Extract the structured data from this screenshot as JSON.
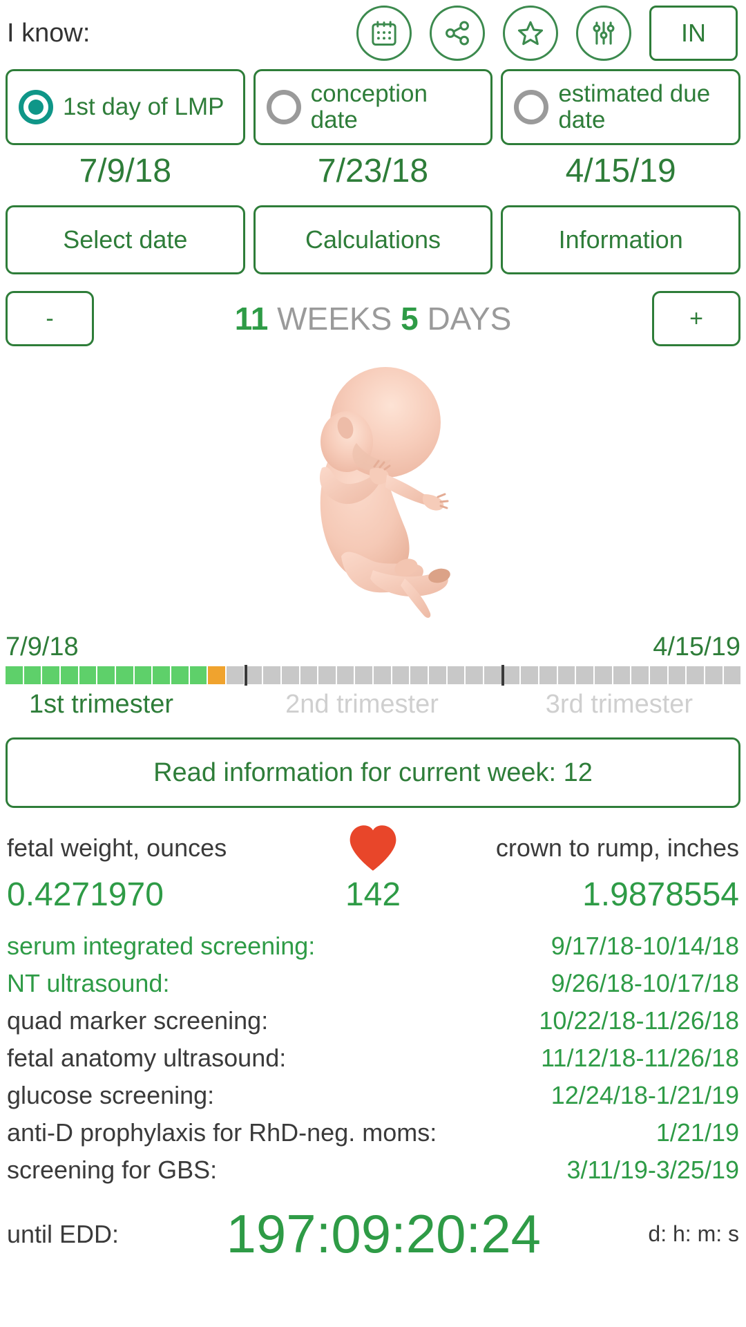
{
  "header": {
    "i_know_label": "I know:",
    "icons": [
      {
        "name": "calendar-icon"
      },
      {
        "name": "share-icon"
      },
      {
        "name": "star-icon"
      },
      {
        "name": "settings-sliders-icon"
      }
    ],
    "in_button_label": "IN"
  },
  "method_options": [
    {
      "label": "1st day of LMP",
      "selected": true,
      "date": "7/9/18"
    },
    {
      "label": "conception date",
      "selected": false,
      "date": "7/23/18"
    },
    {
      "label": "estimated due date",
      "selected": false,
      "date": "4/15/19"
    }
  ],
  "actions": {
    "select_date": "Select date",
    "calculations": "Calculations",
    "information": "Information"
  },
  "stepper": {
    "minus": "-",
    "plus": "+",
    "weeks_value": "11",
    "weeks_unit": "WEEKS",
    "days_value": "5",
    "days_unit": "DAYS"
  },
  "timeline": {
    "start_date": "7/9/18",
    "end_date": "4/15/19",
    "total_weeks": 40,
    "weeks_completed": 11,
    "current_week_index": 11,
    "trimester_ticks": [
      13,
      27
    ],
    "trimester_labels": [
      "1st trimester",
      "2nd trimester",
      "3rd trimester"
    ]
  },
  "read_info_button": "Read information for current week: 12",
  "stats": {
    "weight_label": "fetal weight, ounces",
    "weight_value": "0.4271970",
    "heart_icon": "heart-icon",
    "heartbeat_value": "142",
    "length_label": "crown to rump, inches",
    "length_value": "1.9878554"
  },
  "screenings": [
    {
      "label": "serum integrated screening:",
      "value": "9/17/18-10/14/18",
      "highlight": true
    },
    {
      "label": "NT ultrasound:",
      "value": "9/26/18-10/17/18",
      "highlight": true
    },
    {
      "label": "quad marker screening:",
      "value": "10/22/18-11/26/18",
      "highlight": false
    },
    {
      "label": "fetal anatomy ultrasound:",
      "value": "11/12/18-11/26/18",
      "highlight": false
    },
    {
      "label": "glucose screening:",
      "value": "12/24/18-1/21/19",
      "highlight": false
    },
    {
      "label": "anti-D prophylaxis for RhD-neg. moms:",
      "value": "1/21/19",
      "highlight": false
    },
    {
      "label": "screening for GBS:",
      "value": "3/11/19-3/25/19",
      "highlight": false
    }
  ],
  "countdown": {
    "label": "until EDD:",
    "value": "197:09:20:24",
    "units": "d: h: m: s"
  },
  "colors": {
    "green": "#2e7d39",
    "bright_green": "#2e9b46",
    "teal": "#0f9688",
    "gray": "#9a9a9a",
    "orange": "#f0a32e",
    "progress_green": "#5ed06a",
    "heart_red": "#e8462a"
  }
}
